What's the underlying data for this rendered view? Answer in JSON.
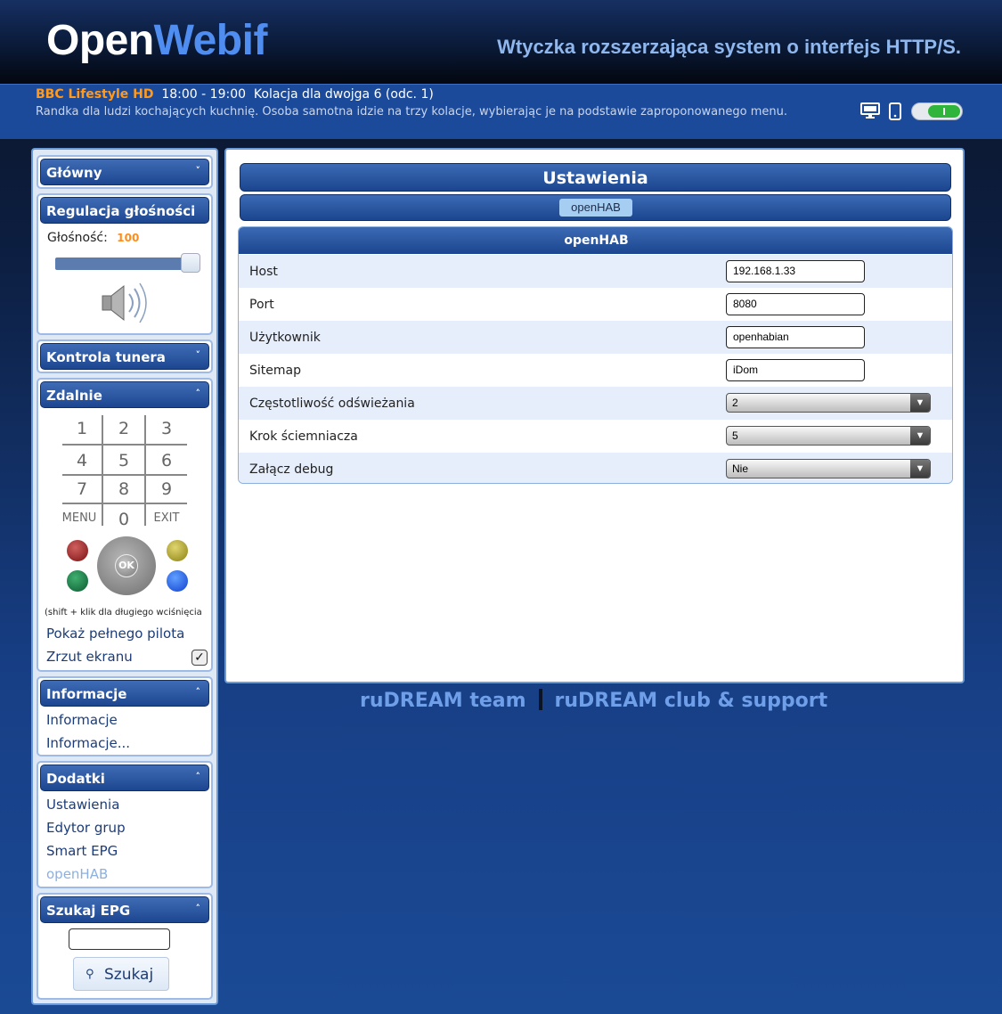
{
  "header": {
    "logo_open": "Open",
    "logo_webif": "Webif",
    "tagline": "Wtyczka rozszerzająca system o interfejs HTTP/S."
  },
  "now_playing": {
    "channel": "BBC Lifestyle HD",
    "time": "18:00 - 19:00",
    "title": "Kolacja dla dwojga 6 (odc. 1)",
    "description": "Randka dla ludzi kochających kuchnię. Osoba samotna idzie na trzy kolacje, wybierając je na podstawie zaproponowanego menu."
  },
  "sidebar": {
    "main": {
      "title": "Główny",
      "chevron": "˅"
    },
    "volume": {
      "title": "Regulacja głośności",
      "label": "Głośność:",
      "value": "100",
      "level": 1.0
    },
    "tuner": {
      "title": "Kontrola tunera",
      "chevron": "˅"
    },
    "remote": {
      "title": "Zdalnie",
      "chevron": "˄",
      "keys": [
        "1",
        "2",
        "3",
        "4",
        "5",
        "6",
        "7",
        "8",
        "9"
      ],
      "menu": "MENU",
      "zero": "0",
      "exit": "EXIT",
      "ok": "OK",
      "hint": "(shift + klik dla długiego wciśnięcia",
      "show_full": "Pokaż pełnego pilota",
      "screenshot": "Zrzut ekranu",
      "screenshot_checked": true
    },
    "info": {
      "title": "Informacje",
      "chevron": "˄",
      "items": [
        "Informacje",
        "Informacje..."
      ]
    },
    "extras": {
      "title": "Dodatki",
      "chevron": "˄",
      "items": [
        "Ustawienia",
        "Edytor grup",
        "Smart EPG",
        "openHAB"
      ],
      "active": "openHAB"
    },
    "epg_search": {
      "title": "Szukaj EPG",
      "chevron": "˄",
      "button": "Szukaj",
      "input_value": ""
    }
  },
  "main": {
    "title": "Ustawienia",
    "tab": "openHAB",
    "section": "openHAB",
    "rows": [
      {
        "label": "Host",
        "type": "text",
        "value": "192.168.1.33"
      },
      {
        "label": "Port",
        "type": "text",
        "value": "8080"
      },
      {
        "label": "Użytkownik",
        "type": "text",
        "value": "openhabian"
      },
      {
        "label": "Sitemap",
        "type": "text",
        "value": "iDom"
      },
      {
        "label": "Częstotliwość odświeżania",
        "type": "select",
        "value": "2"
      },
      {
        "label": "Krok ściemniacza",
        "type": "select",
        "value": "5"
      },
      {
        "label": "Załącz debug",
        "type": "select",
        "value": "Nie"
      }
    ]
  },
  "footer": {
    "team": "ruDREAM team",
    "club": "ruDREAM club & support"
  },
  "colors": {
    "accent": "#1c4a9b",
    "channel": "#ff9a1f",
    "logo_webif": "#4f8ef0",
    "toggle_on": "#2fb43c"
  }
}
